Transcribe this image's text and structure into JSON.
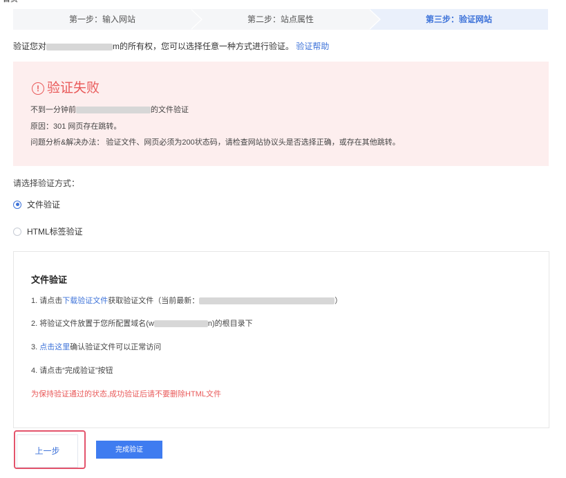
{
  "top_cut_text": "首页",
  "steps": [
    {
      "label": "第一步：输入网站"
    },
    {
      "label": "第二步：站点属性"
    },
    {
      "label": "第三步：验证网站"
    }
  ],
  "intro": {
    "prefix": "验证您对",
    "suffix": "m的所有权，您可以选择任意一种方式进行验证。",
    "help_link": "验证帮助"
  },
  "error": {
    "title": "验证失败",
    "line1_prefix": "不到一分钟前",
    "line1_suffix": "的文件验证",
    "line2": "原因：301 网页存在跳转。",
    "line3": "问题分析&解决办法： 验证文件、网页必须为200状态码，请检查网站协议头是否选择正确，或存在其他跳转。"
  },
  "methods": {
    "label": "请选择验证方式：",
    "options": [
      {
        "label": "文件验证",
        "checked": true
      },
      {
        "label": "HTML标签验证",
        "checked": false
      }
    ]
  },
  "panel": {
    "title": "文件验证",
    "step1_prefix": "1.  请点击",
    "step1_link": "下载验证文件",
    "step1_middle": "获取验证文件（当前最新：",
    "step1_suffix": "）",
    "step2_prefix": "2.  将验证文件放置于您所配置域名(w",
    "step2_suffix": "n)的根目录下",
    "step3_prefix": "3.  ",
    "step3_link": "点击这里",
    "step3_suffix": "确认验证文件可以正常访问",
    "step4": "4.  请点击“完成验证”按钮",
    "warning": "为保持验证通过的状态,成功验证后请不要删除HTML文件"
  },
  "buttons": {
    "prev": "上一步",
    "done": "完成验证"
  },
  "colors": {
    "accent": "#3e73d9",
    "error": "#e95a5a",
    "error_bg": "#fdeeee",
    "primary_button": "#3f7cf0",
    "highlight_outline": "#e3536b"
  }
}
